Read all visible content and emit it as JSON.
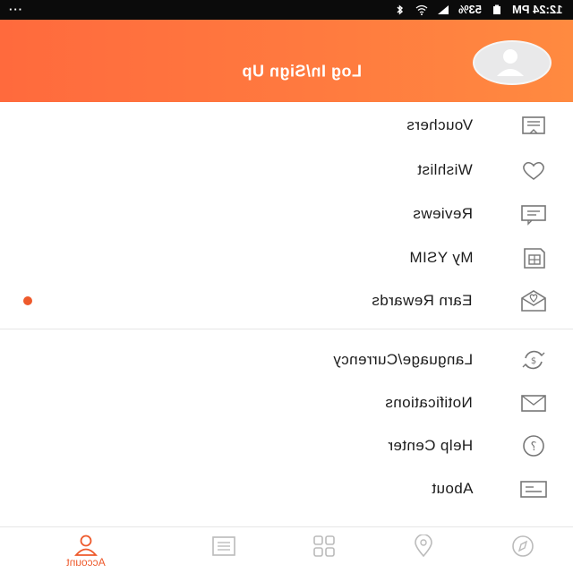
{
  "status_bar": {
    "time": "12:24 PM",
    "battery": "53%",
    "dots": "···"
  },
  "header": {
    "login_label": "Log In/Sign Up"
  },
  "menu": {
    "group1": [
      {
        "label": "Vouchers",
        "icon": "voucher-icon"
      },
      {
        "label": "Wishlist",
        "icon": "heart-icon"
      },
      {
        "label": "Reviews",
        "icon": "chat-icon"
      },
      {
        "label": "My YSIM",
        "icon": "sim-card-icon"
      },
      {
        "label": "Earn Rewards",
        "icon": "gift-mail-icon",
        "badge": true
      }
    ],
    "group2": [
      {
        "label": "Language/Currency",
        "icon": "currency-exchange-icon"
      },
      {
        "label": "Notifications",
        "icon": "envelope-icon"
      },
      {
        "label": "Help Center",
        "icon": "help-icon"
      },
      {
        "label": "About",
        "icon": "info-card-icon"
      }
    ]
  },
  "bottom_nav": {
    "tabs": [
      {
        "label": "Account",
        "icon": "person-icon",
        "active": true
      },
      {
        "label": "",
        "icon": "list-icon"
      },
      {
        "label": "",
        "icon": "grid-icon"
      },
      {
        "label": "",
        "icon": "location-icon"
      },
      {
        "label": "",
        "icon": "compass-icon"
      }
    ],
    "accent": "#ee5a2c"
  },
  "colors": {
    "header_gradient_start": "#ff6a3d",
    "header_gradient_end": "#ff8a40",
    "status_bar": "#0b0b0b",
    "badge": "#ee5a2c"
  }
}
